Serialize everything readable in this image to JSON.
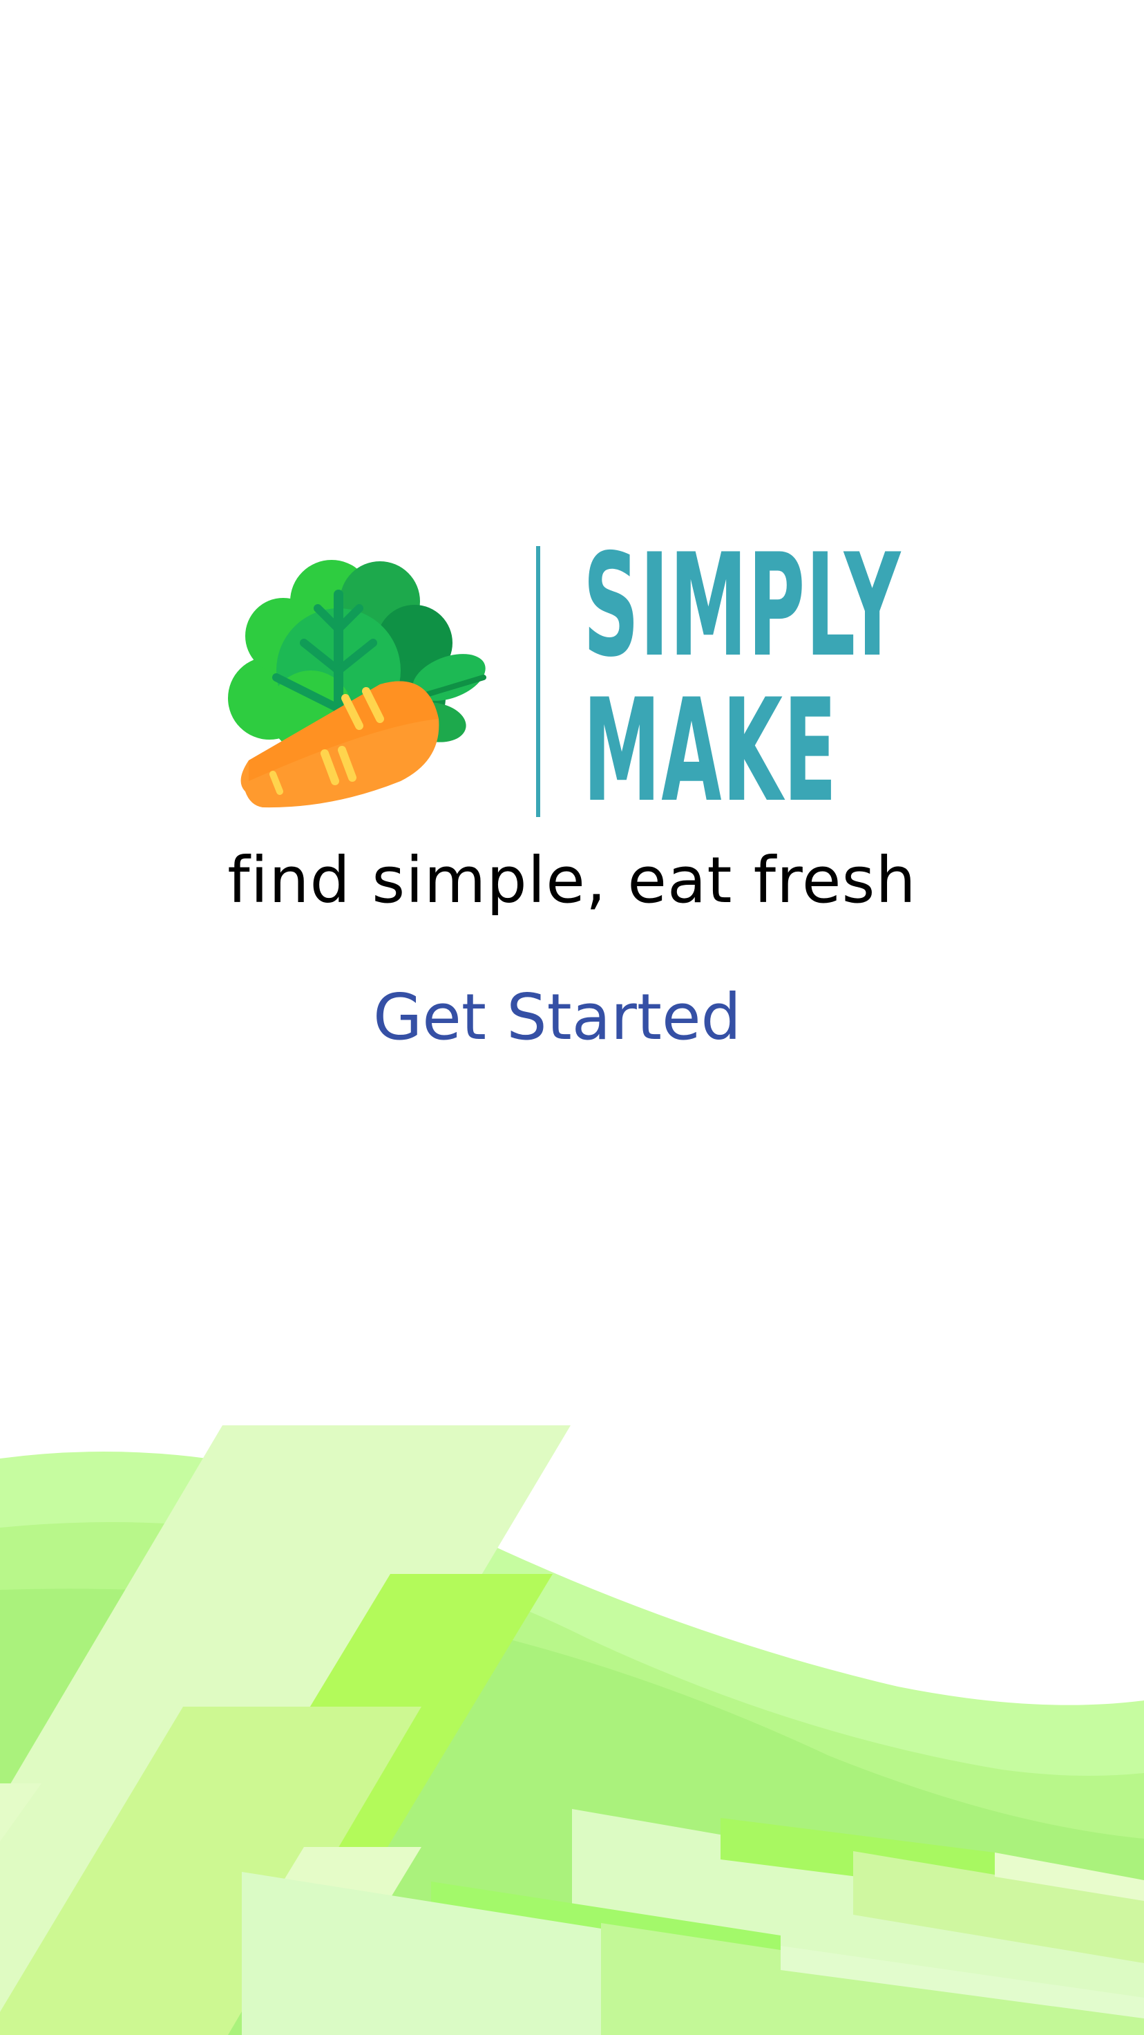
{
  "brand": {
    "line1": "SIMPLY",
    "line2": "MAKE",
    "color": "#3aa6b5"
  },
  "tagline": "find simple, eat fresh",
  "cta": {
    "label": "Get Started",
    "color": "#3550a5"
  },
  "icons": {
    "logo": "broccoli-carrot-icon"
  }
}
